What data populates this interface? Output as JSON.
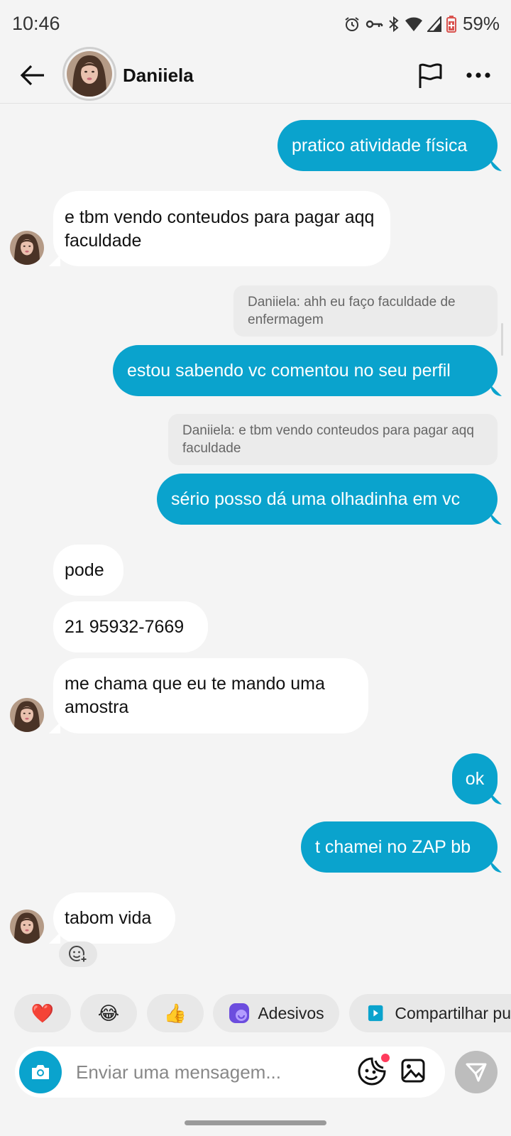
{
  "status_bar": {
    "time": "10:46",
    "battery": "59%",
    "icons": [
      "alarm-icon",
      "vpn-key-icon",
      "bluetooth-icon",
      "wifi-icon",
      "signal-icon",
      "battery-saver-icon"
    ]
  },
  "header": {
    "contact_name": "Daniiela",
    "icons": [
      "back-arrow-icon",
      "flag-icon",
      "more-options-icon"
    ]
  },
  "colors": {
    "outgoing_bubble": "#0aa3cd",
    "incoming_bubble": "#ffffff",
    "background": "#f4f4f4",
    "quote_background": "#ebebeb"
  },
  "messages": [
    {
      "dir": "out",
      "text": "pratico atividade física"
    },
    {
      "dir": "in",
      "text": "e tbm vendo conteudos para pagar aqq faculdade"
    },
    {
      "dir": "quote",
      "text": "Daniiela: ahh eu faço faculdade de enfermagem"
    },
    {
      "dir": "out",
      "text": "estou sabendo vc comentou no seu perfil"
    },
    {
      "dir": "quote",
      "text": "Daniiela: e tbm vendo conteudos para pagar aqq faculdade"
    },
    {
      "dir": "out",
      "text": "sério posso dá uma olhadinha em vc"
    },
    {
      "dir": "in",
      "text": "pode"
    },
    {
      "dir": "in",
      "text": "21 95932-7669"
    },
    {
      "dir": "in",
      "text": "me chama que eu te mando uma amostra"
    },
    {
      "dir": "out",
      "text": "ok"
    },
    {
      "dir": "out",
      "text": "t chamei no ZAP bb"
    },
    {
      "dir": "in",
      "text": "tabom vida"
    }
  ],
  "quick_replies": {
    "heart": "❤️",
    "laugh": "😂",
    "thumbs_up": "👍",
    "stickers": "Adesivos",
    "share": "Compartilhar pu"
  },
  "composer": {
    "placeholder": "Enviar uma mensagem..."
  }
}
